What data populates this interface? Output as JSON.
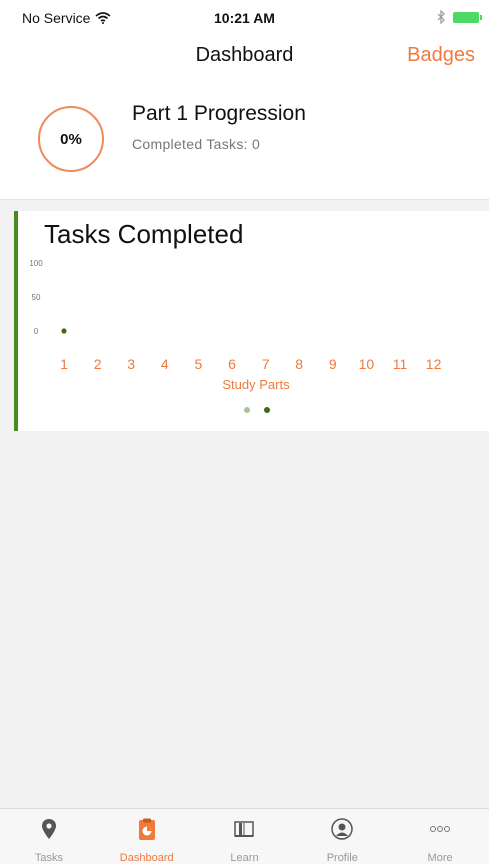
{
  "status_bar": {
    "carrier": "No Service",
    "time": "10:21 AM"
  },
  "nav": {
    "title": "Dashboard",
    "action": "Badges"
  },
  "progress": {
    "percent_label": "0%",
    "title": "Part 1 Progression",
    "subtitle": "Completed Tasks: 0",
    "value": 0
  },
  "tasks_card": {
    "title": "Tasks Completed",
    "page_indicator": {
      "pages": 2,
      "active": 1
    }
  },
  "chart_data": {
    "type": "scatter",
    "title": "Tasks Completed",
    "xlabel": "Study Parts",
    "ylabel": "",
    "categories": [
      "1",
      "2",
      "3",
      "4",
      "5",
      "6",
      "7",
      "8",
      "9",
      "10",
      "11",
      "12"
    ],
    "series": [
      {
        "x": [
          "1"
        ],
        "values": [
          0
        ]
      }
    ],
    "yticks": [
      "100",
      "50",
      "0"
    ],
    "ylim": [
      0,
      100
    ],
    "grid": false
  },
  "tabs": [
    {
      "label": "Tasks",
      "icon": "map-pin-icon",
      "active": false
    },
    {
      "label": "Dashboard",
      "icon": "clipboard-chart-icon",
      "active": true
    },
    {
      "label": "Learn",
      "icon": "book-icon",
      "active": false
    },
    {
      "label": "Profile",
      "icon": "profile-icon",
      "active": false
    },
    {
      "label": "More",
      "icon": "more-dots-icon",
      "active": false
    }
  ],
  "colors": {
    "accent": "#f07a3c",
    "chart_green": "#3d6b12",
    "card_border_green": "#4a8a1c",
    "ring": "#ef8a5c",
    "tab_inactive": "#999999"
  }
}
